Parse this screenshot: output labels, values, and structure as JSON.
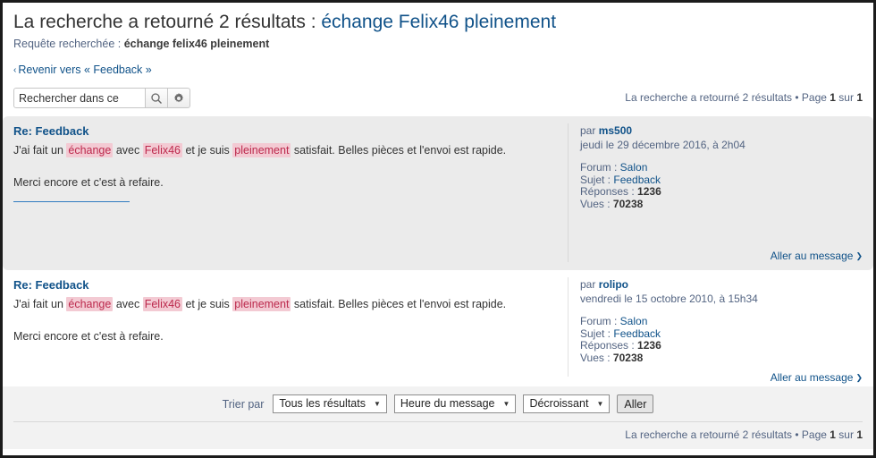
{
  "header": {
    "title_prefix": "La recherche a retourné 2 résultats : ",
    "title_query": "échange Felix46 pleinement",
    "query_label": "Requête recherchée : ",
    "query_value": "échange felix46 pleinement",
    "back_chevron": "‹",
    "back_link": "Revenir vers « Feedback »"
  },
  "search": {
    "value": "Rechercher dans ce",
    "placeholder": "Rechercher dans ces résultats",
    "search_icon": "search-icon",
    "settings_icon": "gear-icon"
  },
  "pagination": {
    "summary_prefix": "La recherche a retourné 2 résultats • Page ",
    "current_page": "1",
    "between": " sur ",
    "total_pages": "1"
  },
  "results": [
    {
      "title": "Re: Feedback",
      "body_prefix": "J'ai fait un ",
      "hl1": "échange",
      "mid1": " avec ",
      "hl2": "Felix46",
      "mid2": " et je suis ",
      "hl3": "pleinement",
      "body_suffix": " satisfait. Belles pièces et l'envoi est rapide.",
      "body_second": "Merci encore et c'est à refaire.",
      "has_empty_link": true,
      "author_label": "par ",
      "author": "ms500",
      "date": "jeudi le 29 décembre 2016, à 2h04",
      "forum_label": "Forum : ",
      "forum": "Salon",
      "topic_label": "Sujet : ",
      "topic": "Feedback",
      "replies_label": "Réponses : ",
      "replies": "1236",
      "views_label": "Vues : ",
      "views": "70238",
      "goto_label": "Aller au message",
      "goto_chevron": "❯"
    },
    {
      "title": "Re: Feedback",
      "body_prefix": "J'ai fait un ",
      "hl1": "échange",
      "mid1": " avec ",
      "hl2": "Felix46",
      "mid2": " et je suis ",
      "hl3": "pleinement",
      "body_suffix": " satisfait. Belles pièces et l'envoi est rapide.",
      "body_second": "Merci encore et c'est à refaire.",
      "has_empty_link": false,
      "author_label": "par ",
      "author": "rolipo",
      "date": "vendredi le 15 octobre 2010, à 15h34",
      "forum_label": "Forum : ",
      "forum": "Salon",
      "topic_label": "Sujet : ",
      "topic": "Feedback",
      "replies_label": "Réponses : ",
      "replies": "1236",
      "views_label": "Vues : ",
      "views": "70238",
      "goto_label": "Aller au message",
      "goto_chevron": "❯"
    }
  ],
  "sortbar": {
    "label": "Trier par",
    "select_scope": "Tous les résultats",
    "select_field": "Heure du message",
    "select_order": "Décroissant",
    "caret": "▼",
    "go_button": "Aller"
  },
  "colors": {
    "link": "#105289",
    "muted": "#536482",
    "highlight_bg": "#f3cad3",
    "highlight_fg": "#bc2a4d",
    "alt_row_bg": "#ebebeb",
    "bar_bg": "#f2f2f2"
  }
}
